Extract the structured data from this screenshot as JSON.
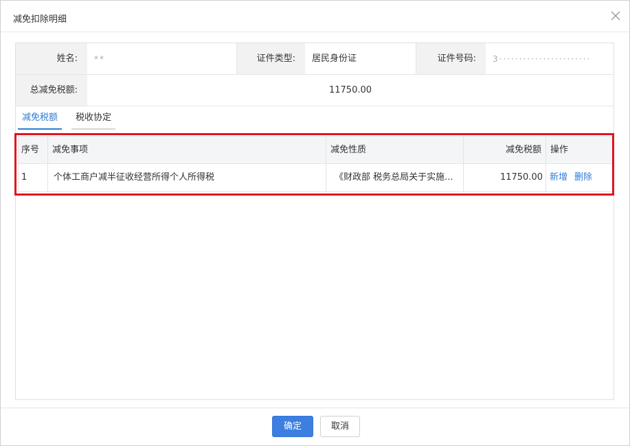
{
  "dialog": {
    "title": "减免扣除明细",
    "close_icon": "close-icon"
  },
  "info": {
    "name_label": "姓名:",
    "name_value": "**",
    "id_type_label": "证件类型:",
    "id_type_value": "居民身份证",
    "id_number_label": "证件号码:",
    "id_number_value": "3·······················",
    "total_label": "总减免税额:",
    "total_value": "11750.00"
  },
  "tabs": [
    {
      "label": "减免税额",
      "active": true
    },
    {
      "label": "税收协定",
      "active": false
    }
  ],
  "table": {
    "headers": [
      "序号",
      "减免事项",
      "减免性质",
      "减免税额",
      "操作"
    ],
    "rows": [
      {
        "index": "1",
        "item": "个体工商户减半征收经营所得个人所得税",
        "nature": "《财政部 税务总局关于实施...",
        "amount": "11750.00",
        "actions": [
          "新增",
          "删除"
        ]
      }
    ]
  },
  "footer": {
    "confirm_label": "确定",
    "cancel_label": "取消"
  },
  "colors": {
    "accent": "#3d7fe0",
    "link": "#2f7cd6",
    "highlight_border": "#e0141e"
  }
}
